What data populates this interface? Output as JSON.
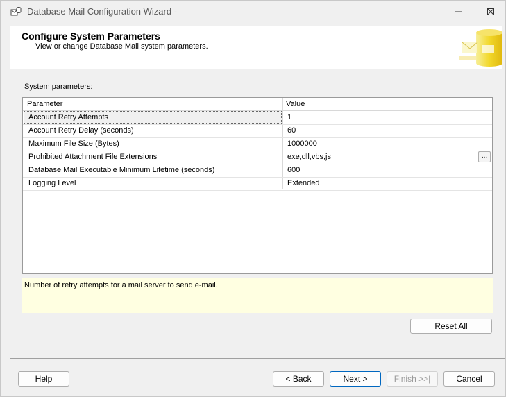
{
  "window": {
    "title": "Database Mail Configuration Wizard -"
  },
  "header": {
    "title": "Configure System Parameters",
    "subtitle": "View or change Database Mail system parameters."
  },
  "section_label": "System parameters:",
  "grid": {
    "columns": [
      "Parameter",
      "Value"
    ],
    "rows": [
      {
        "parameter": "Account Retry Attempts",
        "value": "1"
      },
      {
        "parameter": "Account Retry Delay (seconds)",
        "value": "60"
      },
      {
        "parameter": "Maximum File Size (Bytes)",
        "value": "1000000"
      },
      {
        "parameter": "Prohibited Attachment File Extensions",
        "value": "exe,dll,vbs,js"
      },
      {
        "parameter": "Database Mail Executable Minimum Lifetime (seconds)",
        "value": "600"
      },
      {
        "parameter": "Logging Level",
        "value": "Extended"
      }
    ],
    "ellipsis_label": "...",
    "selected_row": 0
  },
  "description": "Number of retry attempts for a mail server to send e-mail.",
  "buttons": {
    "reset_all": "Reset All",
    "help": "Help",
    "back": "< Back",
    "next": "Next >",
    "finish": "Finish >>|",
    "cancel": "Cancel"
  },
  "colors": {
    "description_bg": "#ffffe1",
    "primary_border": "#0067c0"
  }
}
